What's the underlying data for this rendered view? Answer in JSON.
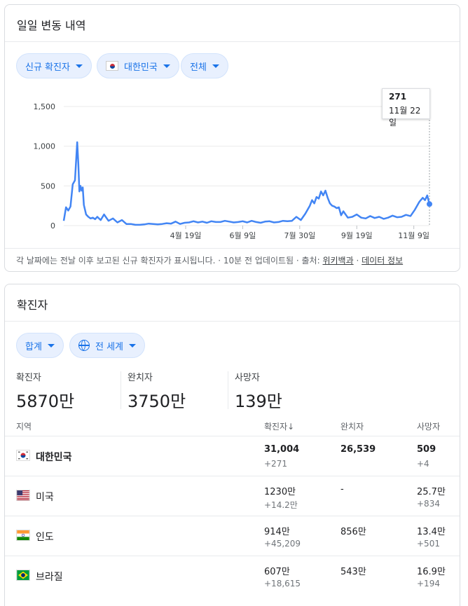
{
  "trend": {
    "title": "일일 변동 내역",
    "chips": [
      {
        "label": "신규 확진자"
      },
      {
        "label": "대한민국"
      },
      {
        "label": "전체"
      }
    ],
    "tooltip": {
      "value": "271",
      "date": "11월 22일"
    },
    "footnote": {
      "text": "각 날짜에는 전날 이후 보고된 신규 확진자가 표시됩니다. · 10분 전 업데이트됨 · 출처:",
      "source_link": "위키백과",
      "data_link": "데이터 정보"
    },
    "colors": {
      "line": "#4285f4",
      "chip_text": "#1a73e8"
    }
  },
  "chart_data": {
    "type": "line",
    "title": "",
    "xlabel": "",
    "ylabel": "",
    "ylim": [
      0,
      1500
    ],
    "y_ticks": [
      "1,500",
      "1,000",
      "500",
      "0"
    ],
    "y_tick_values": [
      1500,
      1000,
      500,
      0
    ],
    "x_tick_labels": [
      "4월 19일",
      "6월 9일",
      "7월 30일",
      "9월 19일",
      "11월 9일"
    ],
    "x_tick_days": [
      109,
      160,
      211,
      262,
      313
    ],
    "grid": true,
    "series": [
      {
        "x": [
          0,
          2,
          4,
          6,
          8,
          10,
          12,
          13,
          14,
          15,
          16,
          17,
          18,
          20,
          22,
          24,
          26,
          28,
          30,
          33,
          36,
          40,
          44,
          48,
          52,
          56,
          60,
          64,
          68,
          72,
          76,
          80,
          84,
          88,
          92,
          96,
          100,
          104,
          108,
          112,
          116,
          120,
          124,
          128,
          132,
          136,
          140,
          144,
          148,
          152,
          156,
          160,
          164,
          168,
          172,
          176,
          180,
          184,
          188,
          192,
          196,
          200,
          204,
          208,
          212,
          216,
          220,
          222,
          224,
          226,
          228,
          230,
          232,
          234,
          236,
          238,
          240,
          242,
          244,
          246,
          248,
          250,
          254,
          258,
          262,
          266,
          270,
          274,
          278,
          282,
          286,
          290,
          294,
          298,
          302,
          306,
          310,
          314,
          318,
          321,
          323,
          325,
          327
        ],
        "values": [
          60,
          230,
          190,
          240,
          520,
          570,
          1050,
          780,
          430,
          500,
          440,
          480,
          260,
          140,
          110,
          90,
          100,
          80,
          110,
          70,
          140,
          60,
          90,
          40,
          70,
          20,
          20,
          10,
          10,
          15,
          25,
          20,
          15,
          20,
          30,
          25,
          50,
          20,
          35,
          40,
          55,
          40,
          50,
          35,
          55,
          45,
          45,
          60,
          50,
          40,
          45,
          55,
          40,
          60,
          45,
          35,
          50,
          55,
          40,
          45,
          60,
          55,
          60,
          110,
          70,
          150,
          250,
          320,
          280,
          360,
          340,
          430,
          380,
          440,
          350,
          280,
          250,
          240,
          220,
          230,
          130,
          180,
          100,
          110,
          140,
          100,
          90,
          120,
          95,
          110,
          85,
          100,
          125,
          105,
          110,
          135,
          120,
          200,
          300,
          350,
          320,
          380,
          271
        ]
      }
    ],
    "tooltip_point": {
      "x": 327,
      "y": 271,
      "label": "11월 22일"
    }
  },
  "cases": {
    "title": "확진자",
    "chips": [
      {
        "label": "합계"
      },
      {
        "label": "전 세계"
      }
    ],
    "stats": [
      {
        "label": "확진자",
        "value": "5870만"
      },
      {
        "label": "완치자",
        "value": "3750만"
      },
      {
        "label": "사망자",
        "value": "139만"
      }
    ],
    "headers": {
      "region": "지역",
      "cases": "확진자",
      "sort_arrow": "↓",
      "recovered": "완치자",
      "deaths": "사망자"
    },
    "rows": [
      {
        "name": "대한민국",
        "flag": "korea-flag-icon",
        "cases": "31,004",
        "cases_delta": "+271",
        "recovered": "26,539",
        "deaths": "509",
        "deaths_delta": "+4"
      },
      {
        "name": "미국",
        "flag": "usa-flag-icon",
        "cases": "1230만",
        "cases_delta": "+14.2만",
        "recovered": "-",
        "deaths": "25.7만",
        "deaths_delta": "+834"
      },
      {
        "name": "인도",
        "flag": "india-flag-icon",
        "cases": "914만",
        "cases_delta": "+45,209",
        "recovered": "856만",
        "deaths": "13.4만",
        "deaths_delta": "+501"
      },
      {
        "name": "브라질",
        "flag": "brazil-flag-icon",
        "cases": "607만",
        "cases_delta": "+18,615",
        "recovered": "543만",
        "deaths": "16.9만",
        "deaths_delta": "+194"
      }
    ]
  }
}
